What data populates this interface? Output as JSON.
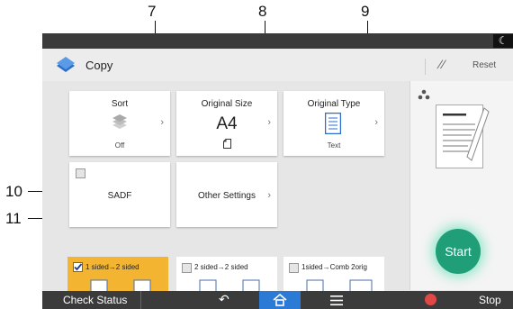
{
  "callouts": [
    "7",
    "8",
    "9",
    "10",
    "11"
  ],
  "app": {
    "title": "Copy",
    "icon": "copy-app-icon"
  },
  "header": {
    "reset_label": "Reset"
  },
  "cards": {
    "sort": {
      "title": "Sort",
      "value": "Off"
    },
    "original_size": {
      "title": "Original Size",
      "value": "A4"
    },
    "original_type": {
      "title": "Original Type",
      "value": "Text"
    },
    "sadf": {
      "title": "SADF"
    },
    "other_settings": {
      "title": "Other Settings"
    }
  },
  "modes": [
    {
      "label": "1 sided→2 sided",
      "checked": true
    },
    {
      "label": "2 sided→2 sided",
      "checked": false
    },
    {
      "label": "1sided→Comb 2orig",
      "checked": false
    }
  ],
  "start_label": "Start",
  "bottom_bar": {
    "check_status": "Check Status",
    "stop": "Stop"
  },
  "colors": {
    "start": "#1f9e77",
    "selected_mode": "#f3b531",
    "bar": "#3b3b3b"
  }
}
